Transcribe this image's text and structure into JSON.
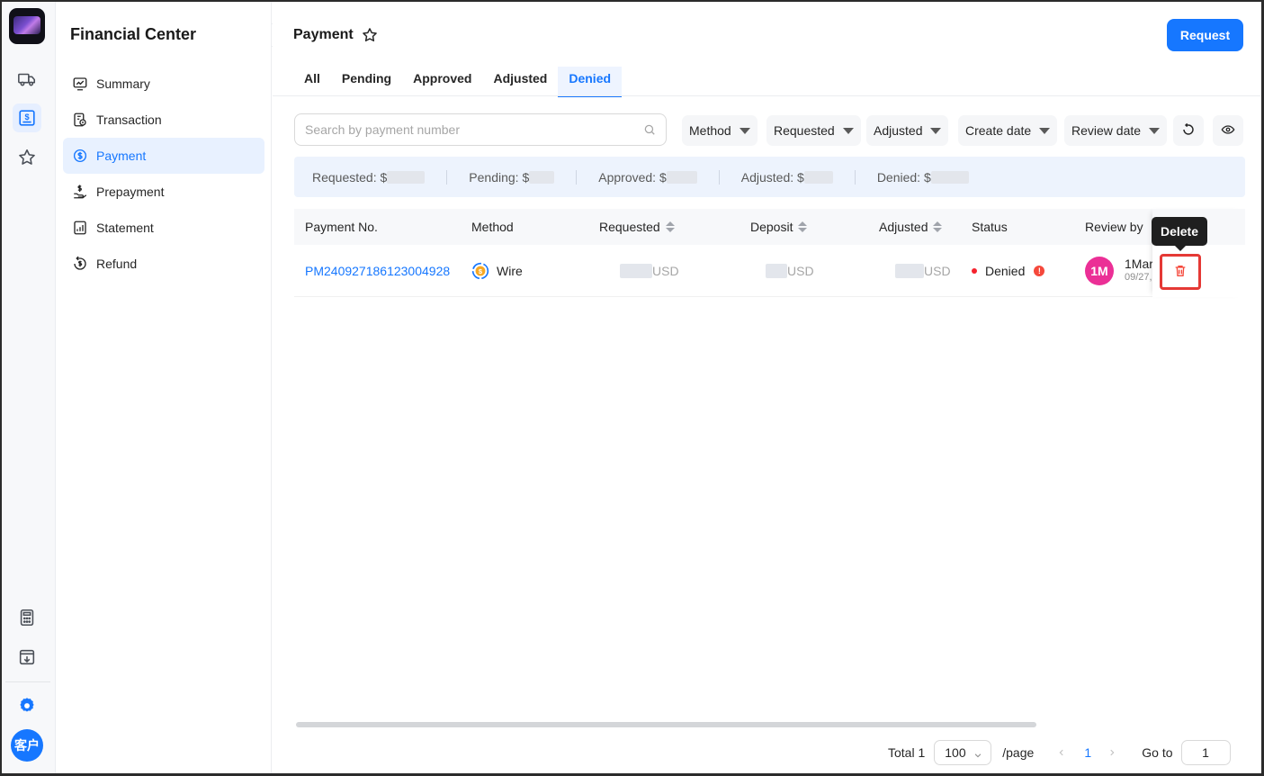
{
  "app": {
    "rail_items": [
      {
        "icon": "truck-icon"
      },
      {
        "icon": "dollar-card-icon",
        "active": true
      },
      {
        "icon": "star-icon"
      },
      {
        "icon": "calculator-icon"
      },
      {
        "icon": "download-list-icon"
      },
      {
        "icon": "gear-icon"
      }
    ],
    "user_avatar": "客户"
  },
  "sidebar": {
    "title": "Financial Center",
    "items": [
      {
        "label": "Summary",
        "icon": "chart-icon"
      },
      {
        "label": "Transaction",
        "icon": "transaction-icon"
      },
      {
        "label": "Payment",
        "icon": "payment-icon",
        "active": true
      },
      {
        "label": "Prepayment",
        "icon": "prepayment-icon"
      },
      {
        "label": "Statement",
        "icon": "statement-icon"
      },
      {
        "label": "Refund",
        "icon": "refund-icon"
      }
    ]
  },
  "header": {
    "title": "Payment",
    "request_label": "Request"
  },
  "tabs": [
    {
      "label": "All"
    },
    {
      "label": "Pending"
    },
    {
      "label": "Approved"
    },
    {
      "label": "Adjusted"
    },
    {
      "label": "Denied",
      "active": true
    }
  ],
  "filters": {
    "search_placeholder": "Search by payment number",
    "dropdowns": [
      "Method",
      "Requested",
      "Adjusted",
      "Create date",
      "Review date"
    ]
  },
  "summary": [
    {
      "label": "Requested: $"
    },
    {
      "label": "Pending: $"
    },
    {
      "label": "Approved: $"
    },
    {
      "label": "Adjusted: $"
    },
    {
      "label": "Denied: $"
    }
  ],
  "table": {
    "columns": [
      "Payment No.",
      "Method",
      "Requested",
      "Deposit",
      "Adjusted",
      "Status",
      "Review by"
    ],
    "rows": [
      {
        "payment_no": "PM240927186123004928",
        "method": "Wire",
        "requested_unit": "USD",
        "deposit_unit": "USD",
        "adjusted_unit": "USD",
        "status": "Denied",
        "reviewer_initials": "1M",
        "reviewer_name": "1Mar",
        "review_date": "09/27,"
      }
    ],
    "delete_tooltip": "Delete"
  },
  "pagination": {
    "total_label": "Total 1",
    "page_size": "100",
    "per_page_label": "/page",
    "current_page": "1",
    "goto_label": "Go to",
    "goto_value": "1"
  },
  "colors": {
    "accent": "#1677ff",
    "denied": "#f5222d",
    "avatar": "#eb2f96"
  }
}
